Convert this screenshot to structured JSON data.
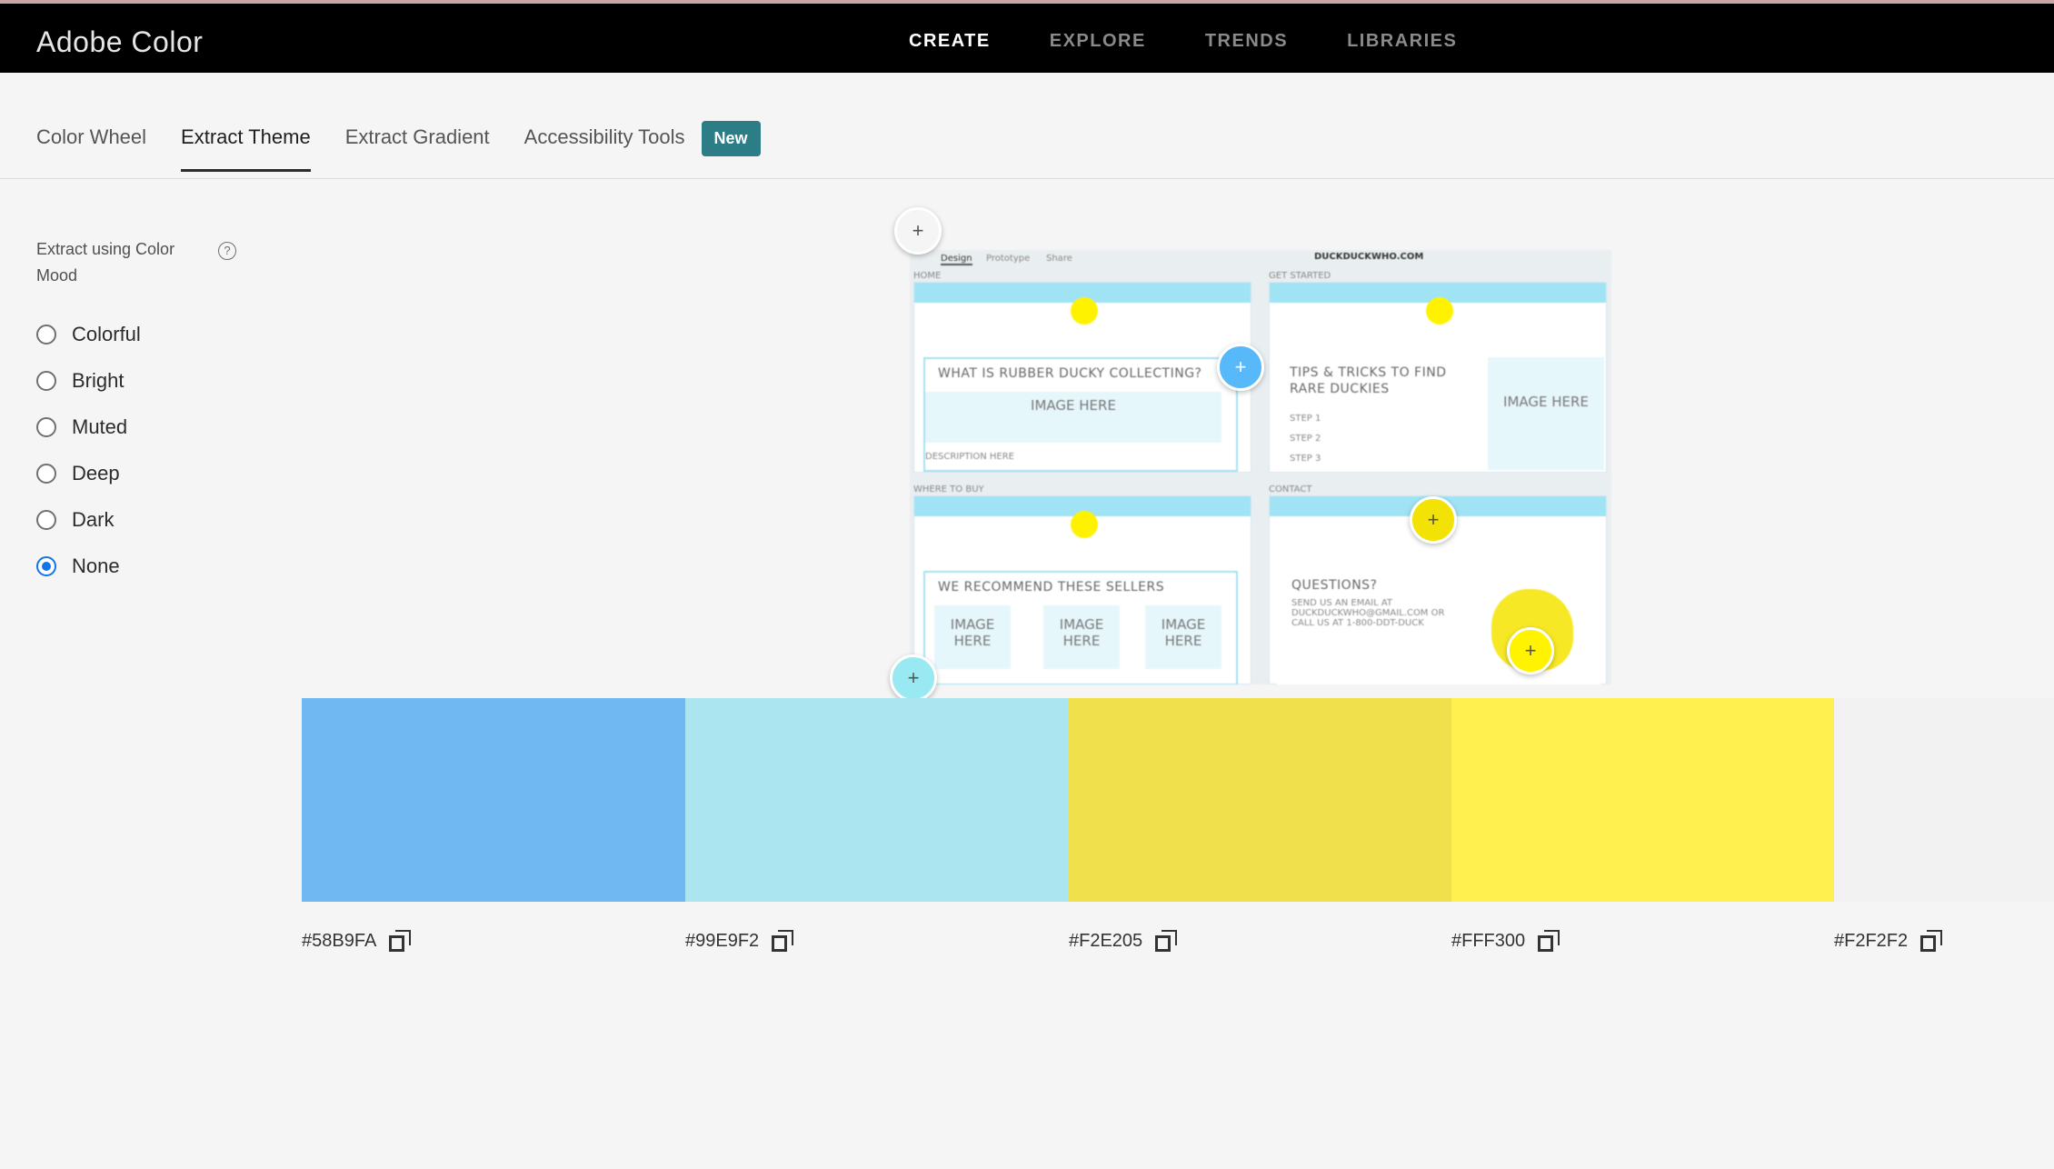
{
  "app": {
    "title": "Adobe Color"
  },
  "nav": {
    "items": [
      {
        "label": "CREATE",
        "active": true
      },
      {
        "label": "EXPLORE",
        "active": false
      },
      {
        "label": "TRENDS",
        "active": false
      },
      {
        "label": "LIBRARIES",
        "active": false
      }
    ]
  },
  "tabs": {
    "items": [
      {
        "label": "Color Wheel",
        "active": false
      },
      {
        "label": "Extract Theme",
        "active": true
      },
      {
        "label": "Extract Gradient",
        "active": false
      },
      {
        "label": "Accessibility Tools",
        "active": false
      }
    ],
    "badge": "New"
  },
  "sidebar": {
    "title": "Extract using Color Mood",
    "help_icon": "question-circle-icon",
    "options": [
      {
        "label": "Colorful",
        "checked": false
      },
      {
        "label": "Bright",
        "checked": false
      },
      {
        "label": "Muted",
        "checked": false
      },
      {
        "label": "Deep",
        "checked": false
      },
      {
        "label": "Dark",
        "checked": false
      },
      {
        "label": "None",
        "checked": true
      }
    ]
  },
  "preview": {
    "tabs": [
      "Design",
      "Prototype",
      "Share"
    ],
    "site": "DUCKDUCKWHO.COM",
    "section_labels": [
      "HOME",
      "GET STARTED",
      "WHERE TO BUY",
      "CONTACT"
    ],
    "card1_title": "WHAT IS RUBBER DUCKY COLLECTING?",
    "card1_image": "IMAGE HERE",
    "card1_desc": "DESCRIPTION HERE",
    "card2_title": "TIPS & TRICKS TO FIND RARE DUCKIES",
    "card2_steps": [
      "STEP 1",
      "STEP 2",
      "STEP 3"
    ],
    "card2_image": "IMAGE HERE",
    "card3_title": "WE RECOMMEND THESE SELLERS",
    "card3_image": "IMAGE HERE",
    "card4_title": "QUESTIONS?",
    "card4_text": "SEND US AN EMAIL AT DUCKDUCKWHO@GMAIL.COM OR CALL US AT 1-800-DDT-DUCK"
  },
  "swatches": [
    {
      "hex": "#58B9FA",
      "color": "#6fb8f2"
    },
    {
      "hex": "#99E9F2",
      "color": "#abe6f0"
    },
    {
      "hex": "#F2E205",
      "color": "#f0e04c"
    },
    {
      "hex": "#FFF300",
      "color": "#fff04f"
    },
    {
      "hex": "#F2F2F2",
      "color": "#f2f2f2"
    }
  ],
  "icons": {
    "copy": "copy-icon",
    "add": "plus-icon"
  }
}
